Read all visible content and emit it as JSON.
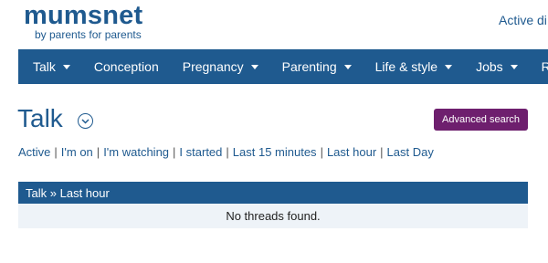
{
  "header": {
    "logo_text": "mumsnet",
    "tagline": "by parents for parents",
    "active_link": "Active di"
  },
  "nav": {
    "items": [
      {
        "label": "Talk"
      },
      {
        "label": "Conception"
      },
      {
        "label": "Pregnancy"
      },
      {
        "label": "Parenting"
      },
      {
        "label": "Life & style"
      },
      {
        "label": "Jobs"
      },
      {
        "label": "Re"
      }
    ]
  },
  "main": {
    "title": "Talk",
    "advanced_search_label": "Advanced search",
    "filters": [
      "Active",
      "I'm on",
      "I'm watching",
      "I started",
      "Last 15 minutes",
      "Last hour",
      "Last Day"
    ],
    "separator": "|",
    "results": {
      "crumb_root": "Talk",
      "crumb_sep": "»",
      "crumb_current": "Last hour",
      "empty_message": "No threads found."
    }
  },
  "colors": {
    "brand_blue": "#1f5a8f",
    "button_purple": "#6e1f6e",
    "row_bg": "#eef3f8"
  }
}
